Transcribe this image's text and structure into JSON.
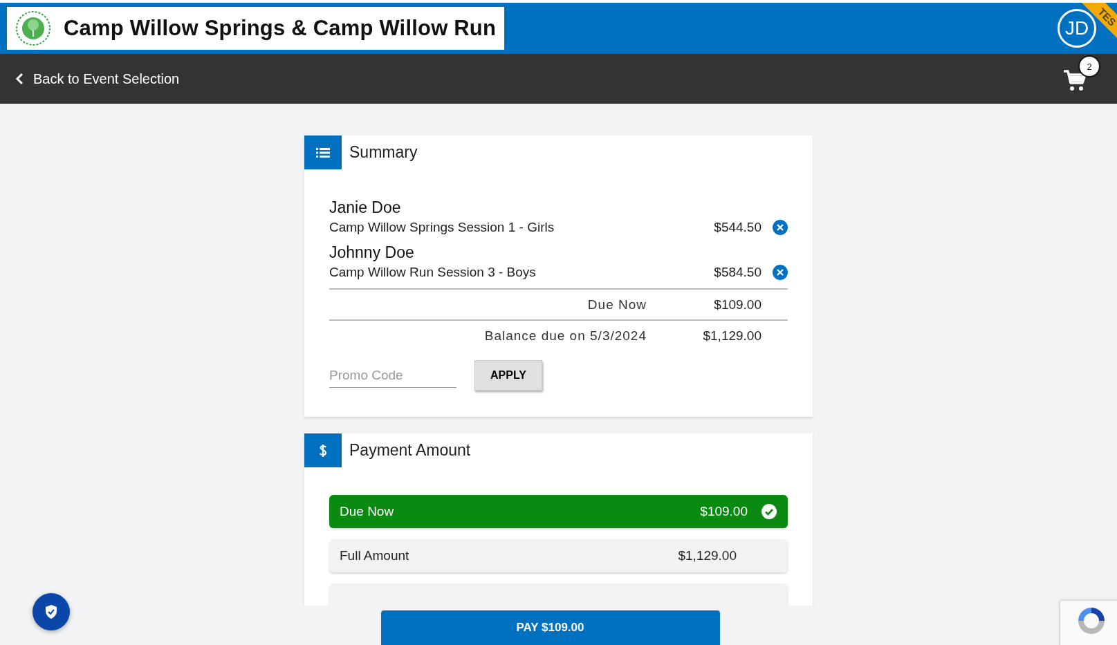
{
  "header": {
    "title": "Camp Willow Springs & Camp Willow Run",
    "avatar": "JD",
    "ribbon": "TES"
  },
  "nav": {
    "back": "Back to Event Selection",
    "cart_count": "2"
  },
  "summary": {
    "title": "Summary",
    "items": [
      {
        "name": "Janie Doe",
        "event": "Camp Willow Springs Session 1 - Girls",
        "price": "$544.50"
      },
      {
        "name": "Johnny Doe",
        "event": "Camp Willow Run Session 3 - Boys",
        "price": "$584.50"
      }
    ],
    "totals": [
      {
        "label": "Due Now",
        "amount": "$109.00"
      },
      {
        "label": "Balance due on 5/3/2024",
        "amount": "$1,129.00"
      }
    ],
    "promo": {
      "placeholder": "Promo Code"
    },
    "apply": "APPLY"
  },
  "payment": {
    "title": "Payment Amount",
    "options": [
      {
        "label": "Due Now",
        "amount": "$109.00",
        "selected": true
      },
      {
        "label": "Full Amount",
        "amount": "$1,129.00",
        "selected": false
      },
      {
        "selected": false
      }
    ]
  },
  "pay_button": "PAY $109.00"
}
